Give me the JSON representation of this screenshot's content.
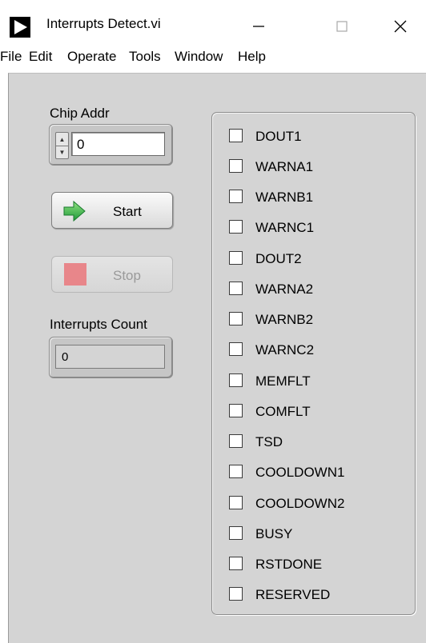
{
  "window": {
    "title": "Interrupts Detect.vi",
    "icon": "labview-run-arrow-icon",
    "controls": [
      "minimize-icon",
      "maximize-icon",
      "close-icon"
    ]
  },
  "menu": [
    "File",
    "Edit",
    "Operate",
    "Tools",
    "Window",
    "Help"
  ],
  "chip_addr": {
    "label": "Chip Addr",
    "value": "0"
  },
  "start_button": {
    "label": "Start",
    "icon": "green-arrow-icon"
  },
  "stop_button": {
    "label": "Stop",
    "icon": "stop-square-icon",
    "enabled": false
  },
  "interrupts_count": {
    "label": "Interrupts Count",
    "value": "0"
  },
  "interrupts": [
    {
      "label": "DOUT1",
      "checked": false
    },
    {
      "label": "WARNA1",
      "checked": false
    },
    {
      "label": "WARNB1",
      "checked": false
    },
    {
      "label": "WARNC1",
      "checked": false
    },
    {
      "label": "DOUT2",
      "checked": false
    },
    {
      "label": "WARNA2",
      "checked": false
    },
    {
      "label": "WARNB2",
      "checked": false
    },
    {
      "label": "WARNC2",
      "checked": false
    },
    {
      "label": "MEMFLT",
      "checked": false
    },
    {
      "label": "COMFLT",
      "checked": false
    },
    {
      "label": "TSD",
      "checked": false
    },
    {
      "label": "COOLDOWN1",
      "checked": false
    },
    {
      "label": "COOLDOWN2",
      "checked": false
    },
    {
      "label": "BUSY",
      "checked": false
    },
    {
      "label": "RSTDONE",
      "checked": false
    },
    {
      "label": "RESERVED",
      "checked": false
    }
  ],
  "colors": {
    "panel_bg": "#d4d4d4",
    "start_arrow": "#3cb54a",
    "stop_square": "#e8868a"
  }
}
